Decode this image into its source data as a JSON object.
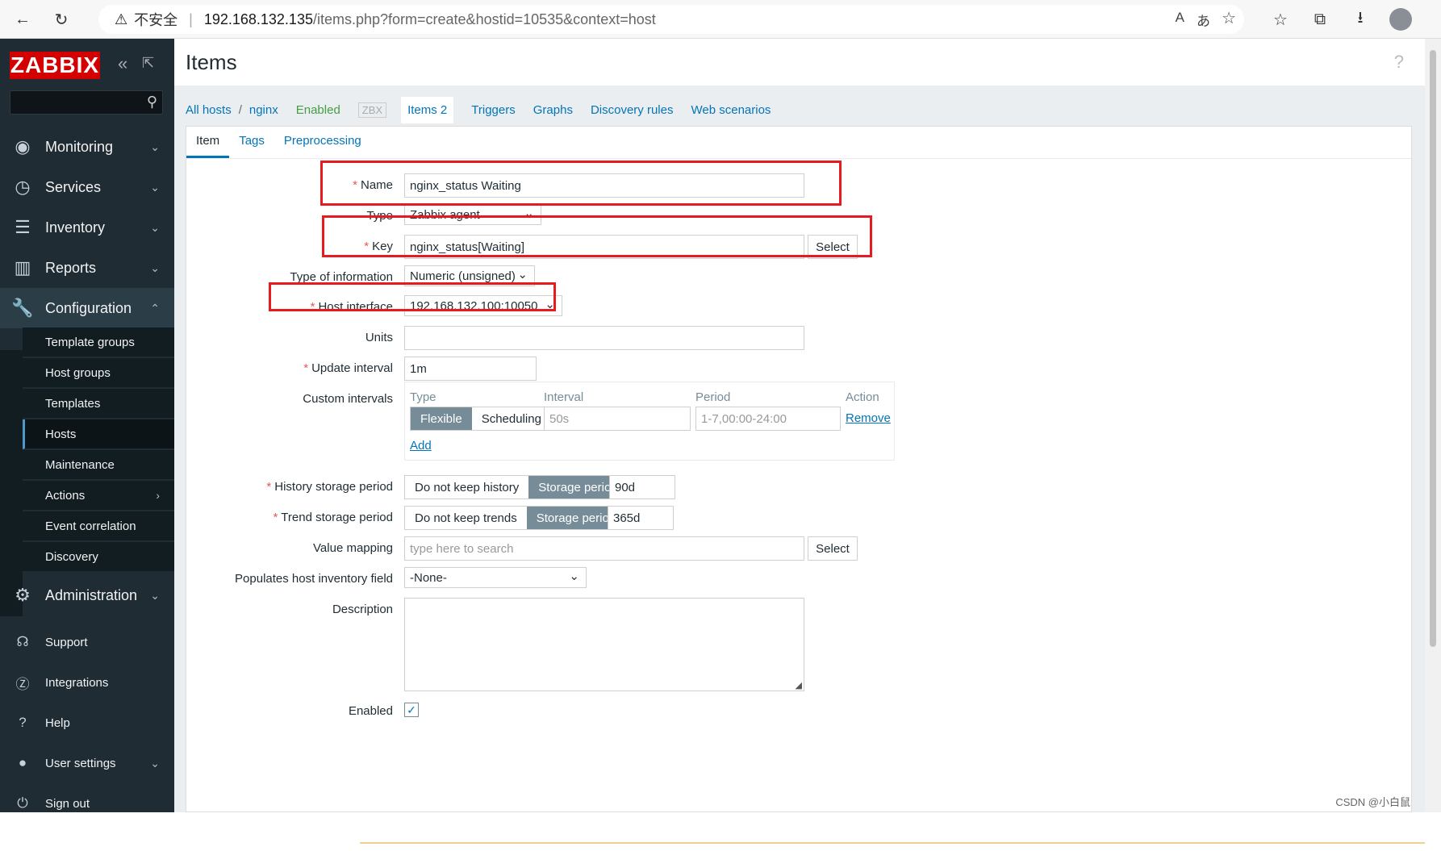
{
  "browser": {
    "insecure_label": "不安全",
    "separator": "|",
    "url_host": "192.168.132.135",
    "url_path": "/items.php?form=create&hostid=10535&context=host"
  },
  "sidebar": {
    "logo": "ZABBIX",
    "menu": [
      {
        "label": "Monitoring",
        "icon": "eye-icon"
      },
      {
        "label": "Services",
        "icon": "clock-icon"
      },
      {
        "label": "Inventory",
        "icon": "list-icon"
      },
      {
        "label": "Reports",
        "icon": "bar-chart-icon"
      },
      {
        "label": "Configuration",
        "icon": "wrench-icon"
      }
    ],
    "config_items": [
      "Template groups",
      "Host groups",
      "Templates",
      "Hosts",
      "Maintenance",
      "Actions",
      "Event correlation",
      "Discovery"
    ],
    "administration": "Administration",
    "bottom": [
      "Support",
      "Integrations",
      "Help",
      "User settings",
      "Sign out"
    ]
  },
  "page": {
    "title": "Items",
    "help": "?"
  },
  "breadcrumbs": {
    "all_hosts": "All hosts",
    "slash": "/",
    "host": "nginx",
    "enabled": "Enabled",
    "zbx": "ZBX",
    "items": "Items 2",
    "triggers": "Triggers",
    "graphs": "Graphs",
    "discovery": "Discovery rules",
    "web": "Web scenarios"
  },
  "tabs": [
    "Item",
    "Tags",
    "Preprocessing"
  ],
  "form": {
    "required_mark": "*",
    "name_label": "Name",
    "name_value": "nginx_status Waiting",
    "type_label": "Type",
    "type_value": "Zabbix agent",
    "key_label": "Key",
    "key_value": "nginx_status[Waiting]",
    "select_label": "Select",
    "toi_label": "Type of information",
    "toi_value": "Numeric (unsigned)",
    "hi_label": "Host interface",
    "hi_value": "192.168.132.100:10050",
    "units_label": "Units",
    "units_value": "",
    "ui_label": "Update interval",
    "ui_value": "1m",
    "ci_label": "Custom intervals",
    "ci_headers": [
      "Type",
      "Interval",
      "Period",
      "Action"
    ],
    "ci_flexible": "Flexible",
    "ci_scheduling": "Scheduling",
    "ci_interval_ph": "50s",
    "ci_period_ph": "1-7,00:00-24:00",
    "ci_remove": "Remove",
    "ci_add": "Add",
    "hist_label": "History storage period",
    "hist_opt1": "Do not keep history",
    "hist_opt2": "Storage period",
    "hist_value": "90d",
    "trend_label": "Trend storage period",
    "trend_opt1": "Do not keep trends",
    "trend_opt2": "Storage period",
    "trend_value": "365d",
    "vm_label": "Value mapping",
    "vm_placeholder": "type here to search",
    "inv_label": "Populates host inventory field",
    "inv_value": "-None-",
    "desc_label": "Description",
    "enabled_label": "Enabled",
    "enabled_checked": true
  },
  "watermark": "CSDN @小白鼠"
}
